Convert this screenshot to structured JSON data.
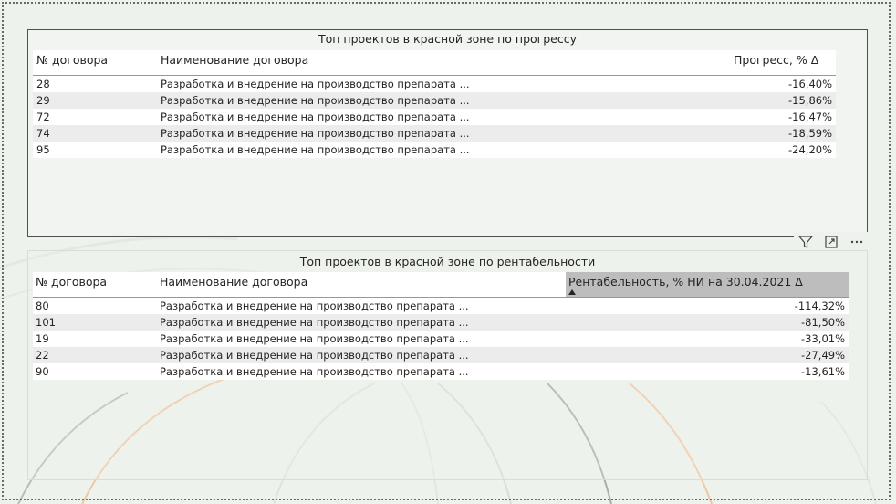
{
  "table1": {
    "title": "Топ проектов в красной зоне по прогрессу",
    "columns": [
      "№ договора",
      "Наименование договора",
      "Прогресс, % Δ"
    ],
    "rows": [
      {
        "no": "28",
        "name": "Разработка и внедрение на производство препарата ...",
        "value": "-16,40%"
      },
      {
        "no": "29",
        "name": "Разработка и внедрение на производство препарата ...",
        "value": "-15,86%"
      },
      {
        "no": "72",
        "name": "Разработка и внедрение на производство препарата ...",
        "value": "-16,47%"
      },
      {
        "no": "74",
        "name": "Разработка и внедрение на производство препарата ...",
        "value": "-18,59%"
      },
      {
        "no": "95",
        "name": "Разработка и внедрение на производство препарата ...",
        "value": "-24,20%"
      }
    ]
  },
  "table2": {
    "title": "Топ проектов в красной зоне по рентабельности",
    "columns": [
      "№ договора",
      "Наименование договора",
      "Рентабельность, % НИ на 30.04.2021 Δ"
    ],
    "rows": [
      {
        "no": "80",
        "name": "Разработка и внедрение на производство препарата ...",
        "value": "-114,32%"
      },
      {
        "no": "101",
        "name": "Разработка и внедрение на производство препарата ...",
        "value": "-81,50%"
      },
      {
        "no": "19",
        "name": "Разработка и внедрение на производство препарата ...",
        "value": "-33,01%"
      },
      {
        "no": "22",
        "name": "Разработка и внедрение на производство препарата ...",
        "value": "-27,49%"
      },
      {
        "no": "90",
        "name": "Разработка и внедрение на производство препарата ...",
        "value": "-13,61%"
      }
    ]
  },
  "visual_header_icons": [
    "filter-icon",
    "focus-mode-icon",
    "more-options-icon"
  ],
  "colors": {
    "accent_line": "#4fb3c4",
    "selected_header": "#bdbdbd",
    "background": "#eef2ec"
  }
}
